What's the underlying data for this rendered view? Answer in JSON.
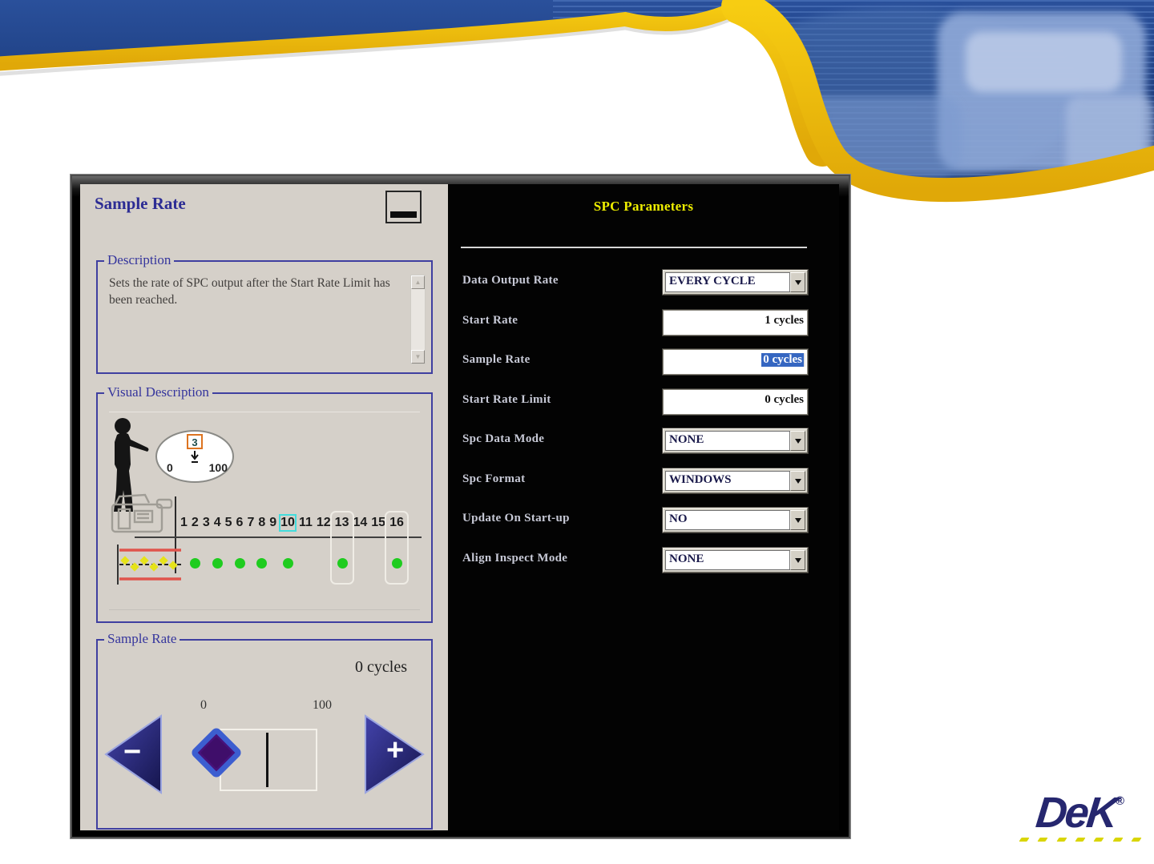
{
  "window": {
    "left_panel": {
      "title": "Sample Rate",
      "minimize_icon": "minimize-icon",
      "description": {
        "legend": "Description",
        "text": "Sets the rate of SPC output after the Start Rate Limit has been reached."
      },
      "visual": {
        "legend": "Visual Description",
        "bubble": {
          "value": "3",
          "min": "0",
          "max": "100"
        },
        "numbers": [
          "1",
          "2",
          "3",
          "4",
          "5",
          "6",
          "7",
          "8",
          "9",
          "10",
          "11",
          "12",
          "13",
          "14",
          "15",
          "16"
        ],
        "highlighted_number": "10",
        "boxed_numbers": [
          "13",
          "16"
        ],
        "dot_numbers": [
          "2",
          "4",
          "6",
          "8",
          "10",
          "13",
          "16"
        ]
      },
      "sample_box": {
        "legend": "Sample Rate",
        "value": "0 cycles",
        "scale_min": "0",
        "scale_max": "100",
        "minus_label": "−",
        "plus_label": "+"
      }
    },
    "right_panel": {
      "title": "SPC Parameters",
      "rows": [
        {
          "label": "Data Output Rate",
          "type": "dropdown",
          "value": "EVERY CYCLE"
        },
        {
          "label": "Start Rate",
          "type": "input",
          "value": "1 cycles"
        },
        {
          "label": "Sample Rate",
          "type": "input",
          "value": "0 cycles",
          "selected": true
        },
        {
          "label": "Start Rate Limit",
          "type": "input",
          "value": "0 cycles"
        },
        {
          "label": "Spc Data Mode",
          "type": "dropdown",
          "value": "NONE"
        },
        {
          "label": "Spc Format",
          "type": "dropdown",
          "value": "WINDOWS"
        },
        {
          "label": "Update On Start-up",
          "type": "dropdown",
          "value": "NO"
        },
        {
          "label": "Align Inspect Mode",
          "type": "dropdown",
          "value": "NONE"
        }
      ]
    }
  },
  "controls": {
    "scroll_up": "▲",
    "scroll_down": "▼",
    "dropdown_arrow": "dropdown-arrow-icon"
  },
  "logo": {
    "text": "DeK",
    "registered": "®",
    "dash_count": 7
  },
  "colors": {
    "page_bg": "#ffffff",
    "header_navy": "#1d3f7f",
    "swoosh_yellow": "#f0ba0c",
    "panel_beige": "#d5d0c9",
    "panel_black": "#030303",
    "fieldset_border": "#3f3fa0",
    "navy_title": "#2c2c94",
    "title_yellow": "#eded00",
    "label_gray": "#c7c9d6",
    "selection_blue": "#3566c1",
    "dot_green": "#1fcc1f",
    "highlight_cyan": "#43dcdc",
    "box_orange": "#dd7420",
    "logo_navy": "#26276f",
    "logo_yellow": "#d9d504"
  }
}
